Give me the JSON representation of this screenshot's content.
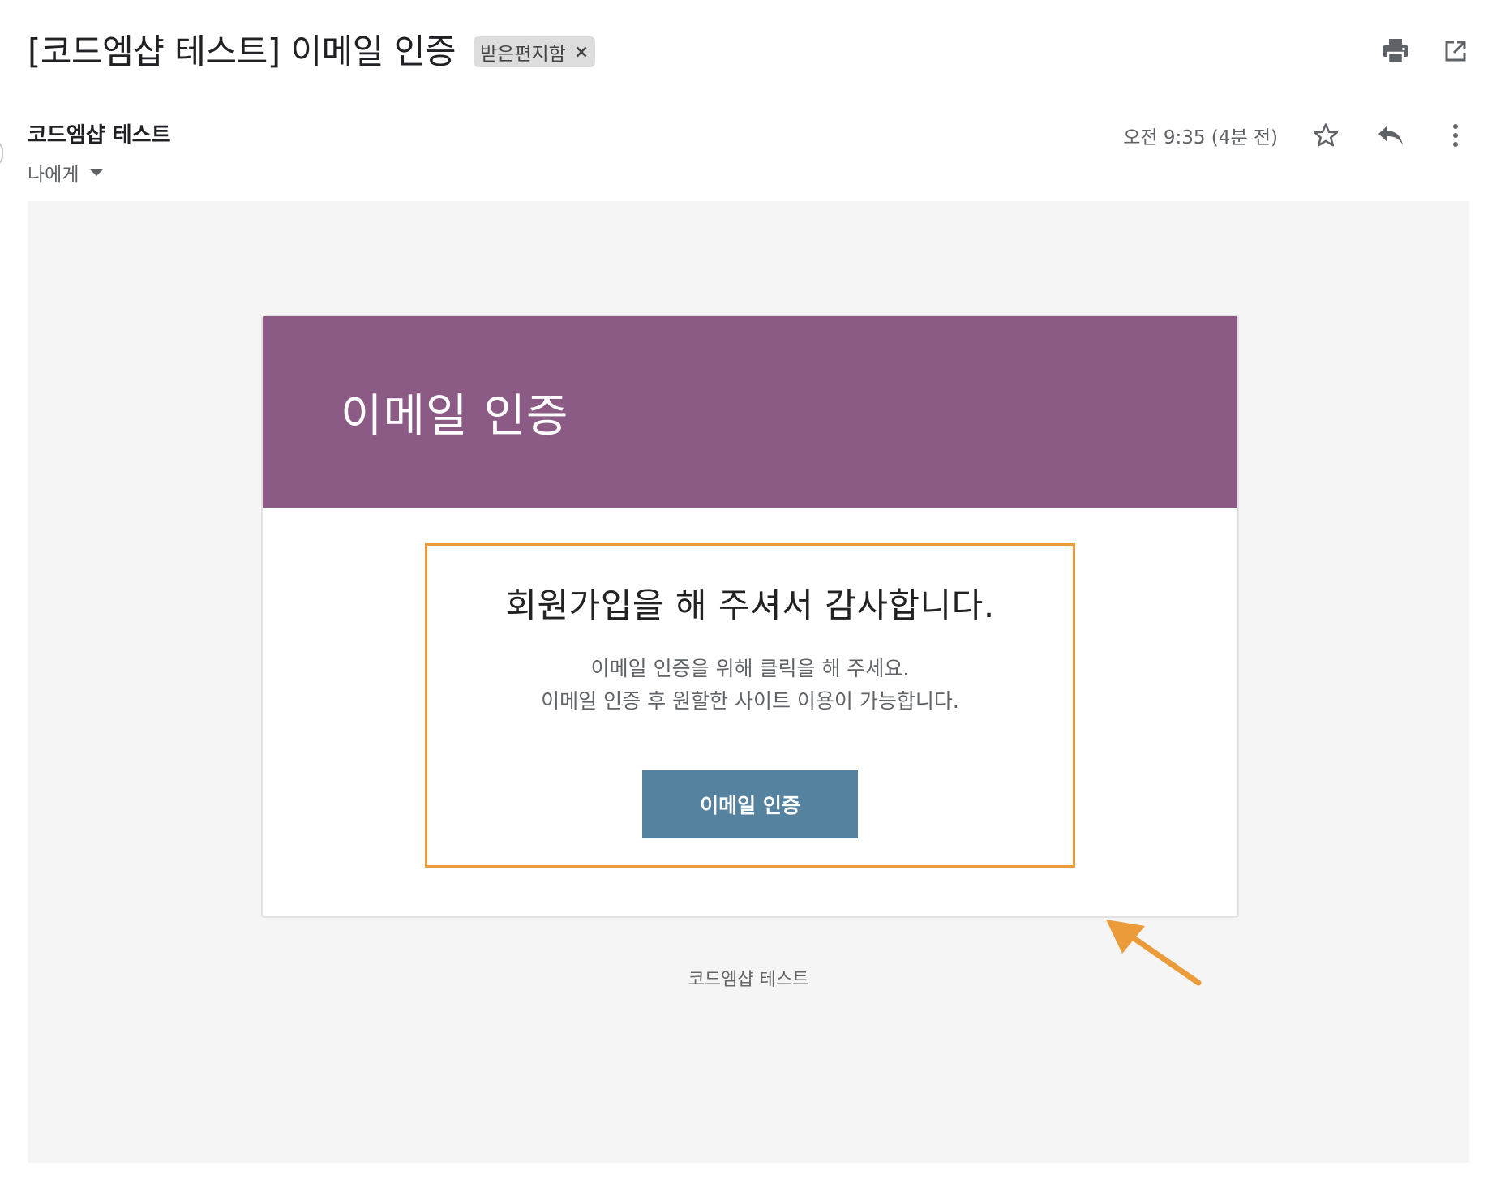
{
  "subject": {
    "title": "[코드엠샵 테스트] 이메일 인증",
    "label": "받은편지함",
    "label_remove": "×"
  },
  "top_actions": {
    "print_icon": "print-icon",
    "open_new_window_icon": "open-in-new-window-icon"
  },
  "sender": {
    "name": "코드엠샵 테스트",
    "recipient": "나에게"
  },
  "meta": {
    "timestamp": "오전 9:35 (4분 전)",
    "star_icon": "star-icon",
    "reply_icon": "reply-icon",
    "more_icon": "more-vertical-icon"
  },
  "email": {
    "header_title": "이메일 인증",
    "thanks": "회원가입을 해 주셔서 감사합니다.",
    "desc_line1": "이메일 인증을 위해 클릭을 해 주세요.",
    "desc_line2": "이메일 인증 후 원할한 사이트 이용이 가능합니다.",
    "button_label": "이메일 인증",
    "footer": "코드엠샵 테스트"
  },
  "colors": {
    "header_bg": "#8b5a85",
    "button_bg": "#55839f",
    "highlight": "#ec9b3a",
    "body_bg": "#f5f5f5"
  }
}
